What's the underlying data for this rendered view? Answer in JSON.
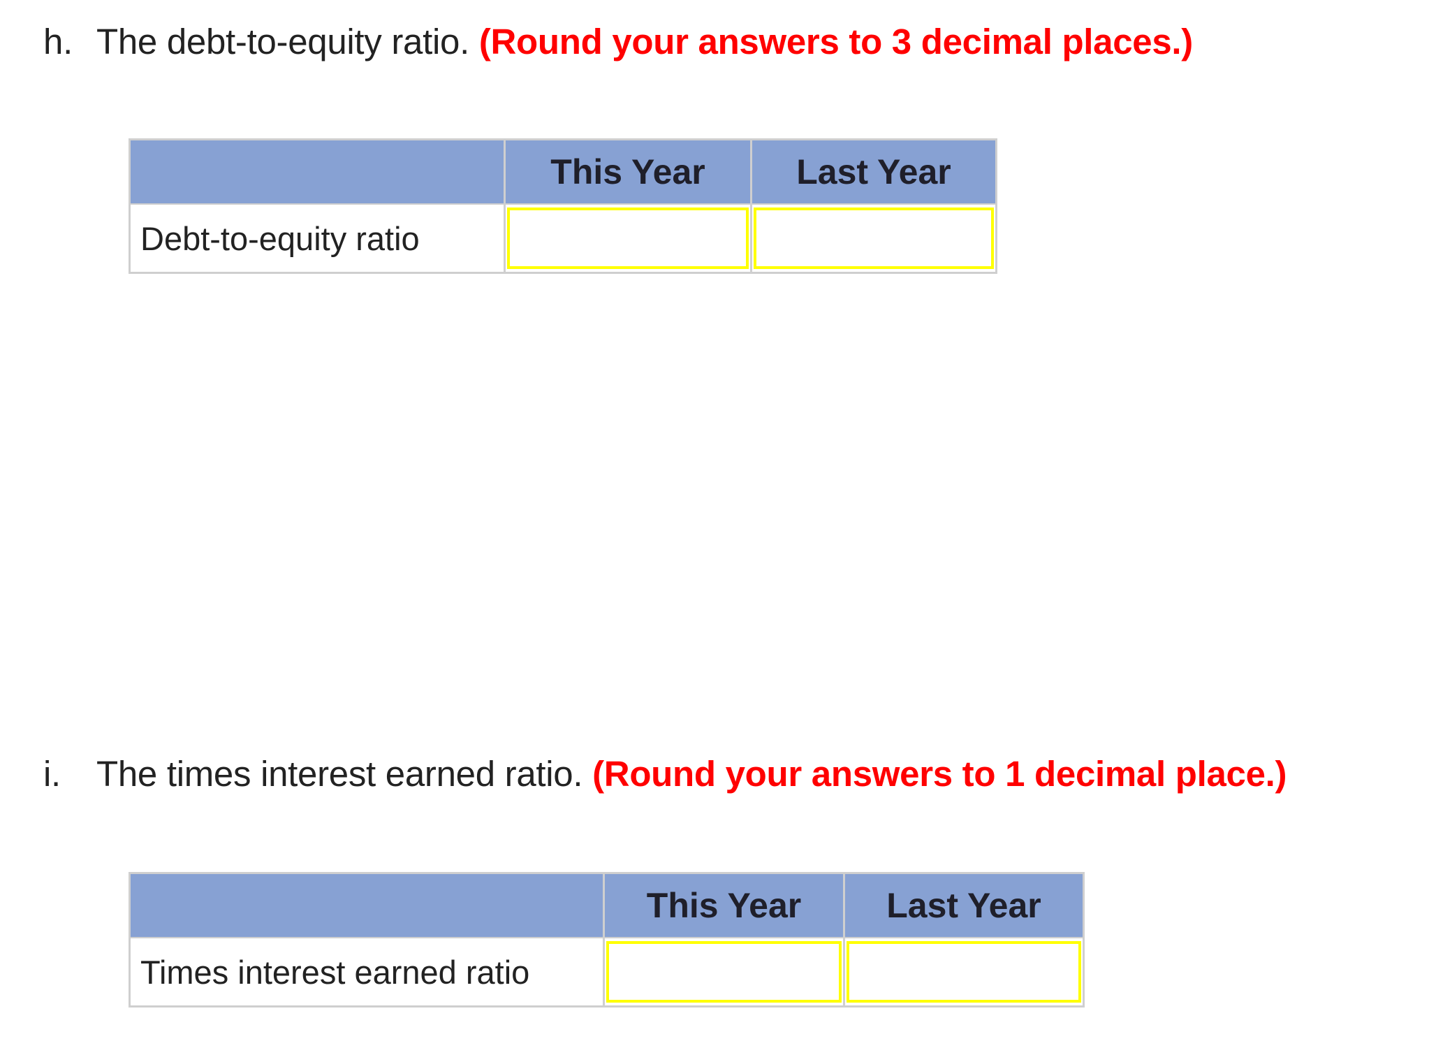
{
  "questions": [
    {
      "letter": "h.",
      "prompt": "The debt-to-equity ratio.",
      "instruction": "(Round your answers to 3 decimal places.)",
      "table": {
        "headers": [
          "",
          "This Year",
          "Last Year"
        ],
        "row_label": "Debt-to-equity ratio",
        "values": {
          "this_year": "",
          "last_year": ""
        }
      }
    },
    {
      "letter": "i.",
      "prompt": "The times interest earned ratio.",
      "instruction": "(Round your answers to 1 decimal place.)",
      "table": {
        "headers": [
          "",
          "This Year",
          "Last Year"
        ],
        "row_label": "Times interest earned ratio",
        "values": {
          "this_year": "",
          "last_year": ""
        }
      }
    }
  ],
  "colors": {
    "instruction": "#ff0000",
    "header_bg": "#87a1d3",
    "input_border": "#ffff00",
    "table_border": "#cfcfcf"
  }
}
